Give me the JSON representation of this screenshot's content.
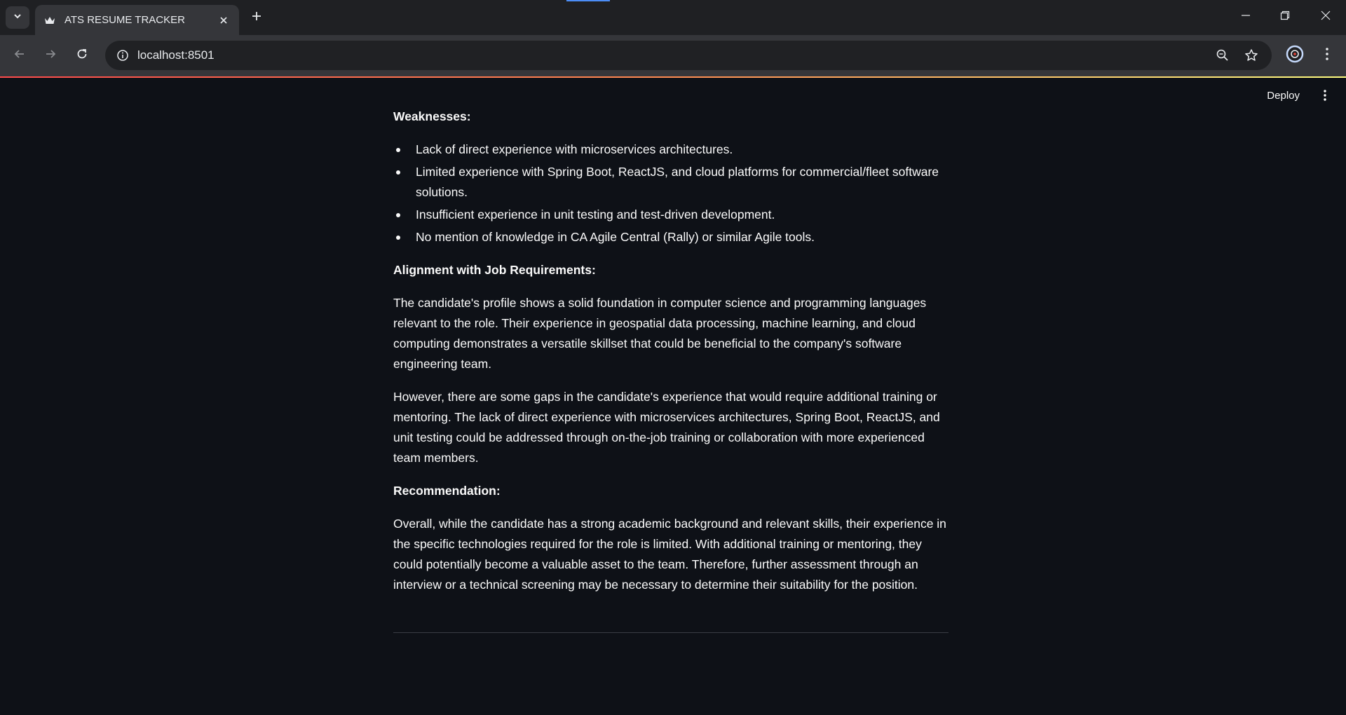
{
  "browser": {
    "tab_title": "ATS RESUME TRACKER",
    "url": "localhost:8501"
  },
  "app": {
    "deploy_label": "Deploy"
  },
  "report": {
    "weaknesses_heading": "Weaknesses:",
    "weaknesses": [
      "Lack of direct experience with microservices architectures.",
      "Limited experience with Spring Boot, ReactJS, and cloud platforms for commercial/fleet software solutions.",
      "Insufficient experience in unit testing and test-driven development.",
      "No mention of knowledge in CA Agile Central (Rally) or similar Agile tools."
    ],
    "alignment_heading": "Alignment with Job Requirements:",
    "alignment_paragraphs": [
      "The candidate's profile shows a solid foundation in computer science and programming languages relevant to the role. Their experience in geospatial data processing, machine learning, and cloud computing demonstrates a versatile skillset that could be beneficial to the company's software engineering team.",
      "However, there are some gaps in the candidate's experience that would require additional training or mentoring. The lack of direct experience with microservices architectures, Spring Boot, ReactJS, and unit testing could be addressed through on-the-job training or collaboration with more experienced team members."
    ],
    "recommendation_heading": "Recommendation:",
    "recommendation_paragraph": "Overall, while the candidate has a strong academic background and relevant skills, their experience in the specific technologies required for the role is limited. With additional training or mentoring, they could potentially become a valuable asset to the team. Therefore, further assessment through an interview or a technical screening may be necessary to determine their suitability for the position."
  }
}
